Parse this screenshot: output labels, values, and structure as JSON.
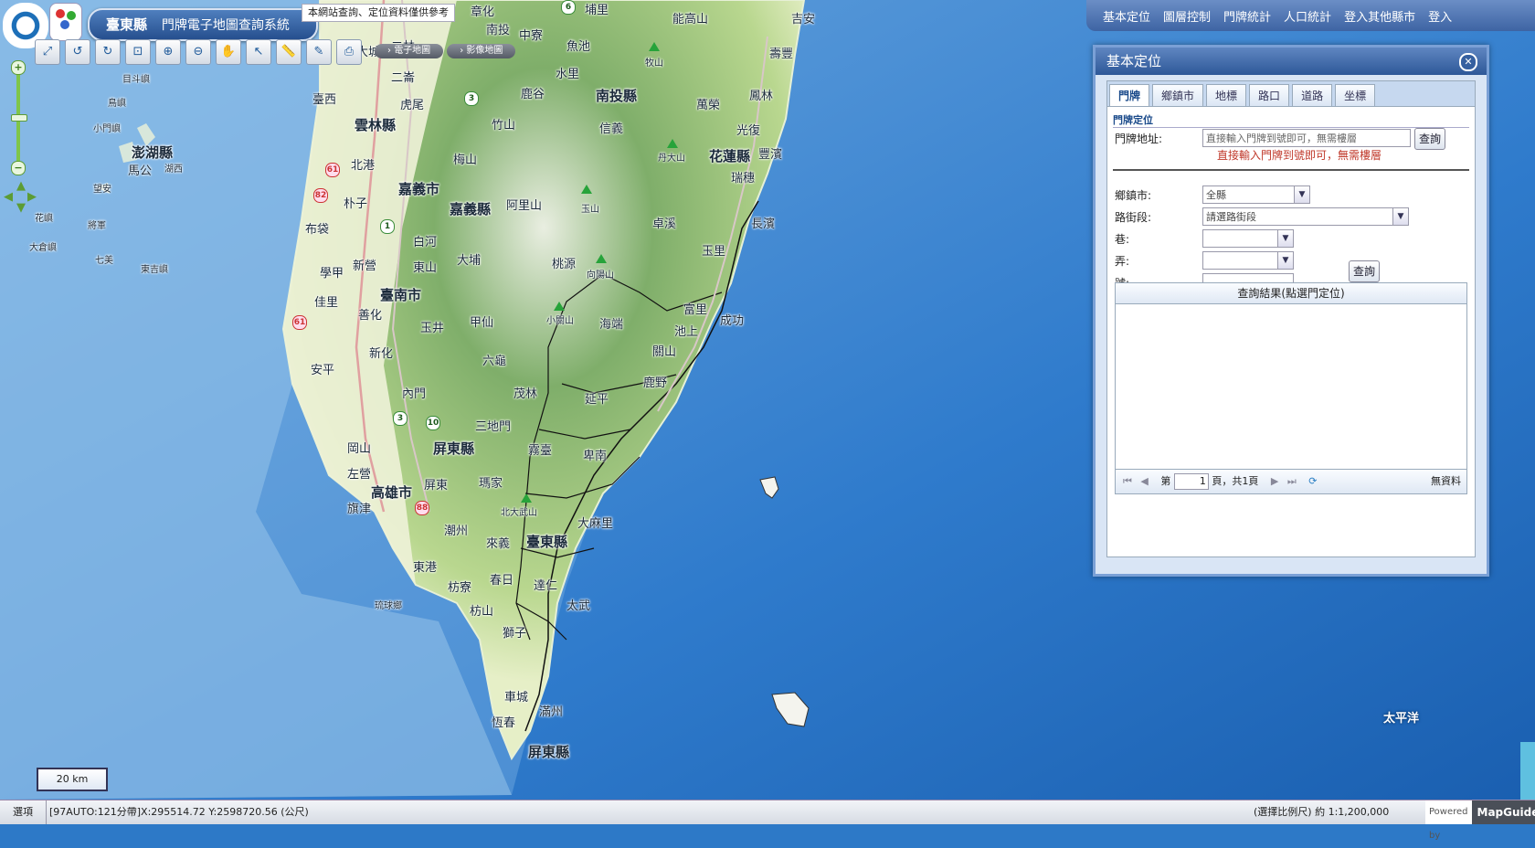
{
  "title": {
    "county": "臺東縣",
    "system": "門牌電子地圖查詢系統"
  },
  "notice": "本網站查詢、定位資料僅供參考",
  "map_type": [
    "電子地圖",
    "影像地圖"
  ],
  "toolbar": [
    {
      "name": "full-extent-icon",
      "glyph": "⤢"
    },
    {
      "name": "previous-view-icon",
      "glyph": "↺"
    },
    {
      "name": "next-view-icon",
      "glyph": "↻"
    },
    {
      "name": "zoom-window-icon",
      "glyph": "⊡"
    },
    {
      "name": "zoom-in-icon",
      "glyph": "⊕"
    },
    {
      "name": "zoom-out-icon",
      "glyph": "⊖"
    },
    {
      "name": "pan-icon",
      "glyph": "✋"
    },
    {
      "name": "select-icon",
      "glyph": "↖"
    },
    {
      "name": "measure-icon",
      "glyph": "📏"
    },
    {
      "name": "draw-icon",
      "glyph": "✎"
    },
    {
      "name": "print-icon",
      "glyph": "⎙"
    }
  ],
  "top_menu": [
    "基本定位",
    "圖層控制",
    "門牌統計",
    "人口統計",
    "登入其他縣市",
    "登入"
  ],
  "panel": {
    "title": "基本定位",
    "tabs": [
      "門牌",
      "鄉鎮市",
      "地標",
      "路口",
      "道路",
      "坐標"
    ],
    "active_tab": 0,
    "section": "門牌定位",
    "address_label": "門牌地址:",
    "address_placeholder": "直接輸入門牌到號即可，無需樓層",
    "query_button": "查詢",
    "hint": "直接輸入門牌到號即可，無需樓層",
    "township_label": "鄉鎮市:",
    "township_value": "全縣",
    "road_label": "路街段:",
    "road_value": "請選路街段",
    "lane_label": "巷:",
    "alley_label": "弄:",
    "number_label": "號:",
    "query_button2": "查詢",
    "result_title": "查詢結果(點選門定位)",
    "pager": {
      "prefix": "第",
      "page": "1",
      "suffix": "頁，共1頁",
      "empty": "無資料"
    }
  },
  "scale_bar": "20 km",
  "status": {
    "options": "選項",
    "coords": "[97AUTO:121分帶]X:295514.72 Y:2598720.56 (公尺)",
    "scale": "(選擇比例尺) 約 1:1,200,000",
    "powered": "Powered by",
    "brand": "MapGuide"
  },
  "map_labels": [
    "章化",
    "中寮",
    "埔里",
    "能高山",
    "吉安",
    "南投",
    "魚池",
    "大城",
    "二林",
    "壽豐",
    "牧山",
    "二崙",
    "水里",
    "鹿谷",
    "南投縣",
    "萬榮",
    "鳳林",
    "臺西",
    "虎尾",
    "竹山",
    "信義",
    "光復",
    "雲林縣",
    "花蓮縣",
    "北港",
    "梅山",
    "丹大山",
    "豐濱",
    "嘉義市",
    "瑞穗",
    "朴子",
    "玉山",
    "嘉義縣",
    "阿里山",
    "卓溪",
    "長濱",
    "布袋",
    "白河",
    "大埔",
    "玉里",
    "學甲",
    "新營",
    "東山",
    "桃源",
    "向陽山",
    "佳里",
    "臺南市",
    "善化",
    "玉井",
    "甲仙",
    "小關山",
    "海端",
    "富里",
    "池上",
    "成功",
    "安平",
    "新化",
    "六龜",
    "關山",
    "鹿野",
    "內門",
    "茂林",
    "延平",
    "三地門",
    "岡山",
    "屏東縣",
    "霧臺",
    "卑南",
    "左營",
    "高雄市",
    "屏東",
    "瑪家",
    "旗津",
    "北大武山",
    "潮州",
    "來義",
    "臺東縣",
    "大麻里",
    "東港",
    "枋寮",
    "春日",
    "達仁",
    "琉球鄉",
    "枋山",
    "太武",
    "獅子",
    "車城",
    "滿州",
    "恆春",
    "屏東縣",
    "目斗嶼",
    "鳥嶼",
    "小門嶼",
    "澎湖縣",
    "湖西",
    "馬公",
    "望安",
    "花嶼",
    "大倉嶼",
    "將軍",
    "七美",
    "東吉嶼",
    "太平洋"
  ]
}
